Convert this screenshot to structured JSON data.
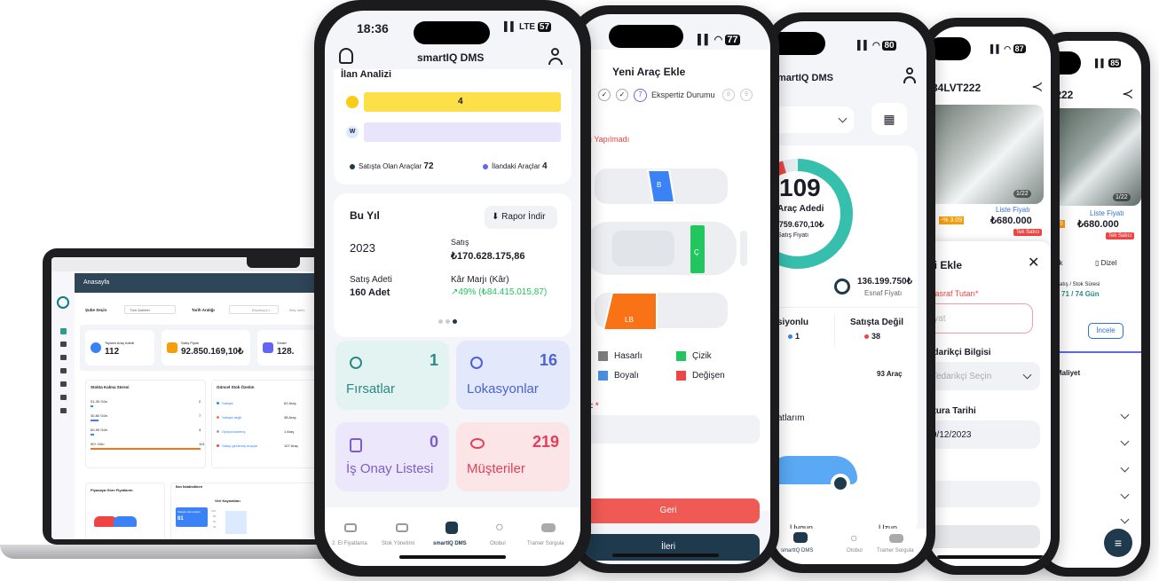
{
  "laptop": {
    "title": "Anasayfa",
    "branch_label": "Şube Seçin",
    "branch_value": "Tüm Şubeler",
    "date_label": "Tarih Aralığı",
    "date_start": "Başlangıç t...",
    "date_end": "Bitiş tarihi",
    "stats": [
      {
        "label": "Toplam Araç Adedi",
        "value": "112"
      },
      {
        "label": "Satış Fiyatı",
        "value": "92.850.169,10₺"
      },
      {
        "label": "Smart",
        "value": "128."
      }
    ],
    "stock_title": "Stokta Kalma Süresi",
    "stock_rows": [
      {
        "label": "01-30 Gün",
        "value": "2",
        "fill": 0.02
      },
      {
        "label": "30-60 Gün",
        "value": "7",
        "fill": 0.07
      },
      {
        "label": "60-90 Gün",
        "value": "3",
        "fill": 0.03
      },
      {
        "label": "90+ Gün",
        "value": "101",
        "fill": 1
      }
    ],
    "summary_title": "Güncel Stok Özetim",
    "summary_rows": [
      {
        "label": "Satışta",
        "value": "81 Araç",
        "color": "#3b82f6"
      },
      {
        "label": "Satışta değil",
        "value": "38 Araç",
        "color": "#f87171"
      },
      {
        "label": "Opsiyonlanmış",
        "value": "1 Araç",
        "color": "#a3a3a3"
      },
      {
        "label": "Satışı gecikmiş araçlar",
        "value": "107 Araç",
        "color": "#ef4444"
      }
    ],
    "market_title": "Piyasaya Göre Fiyatlarım",
    "ad_title": "İlan İstatistikleri",
    "source_title": "Veri Kaynakları",
    "source_box": "Satışta olan araçlar",
    "source_value": "81",
    "y_ticks": [
      "100",
      "80",
      "60",
      "40"
    ]
  },
  "phone1": {
    "time": "18:36",
    "signal": "LTE",
    "battery": "57",
    "app_title": "smartIQ DMS",
    "section": "İlan Analizi",
    "bar1_value": "4",
    "legend1_label": "Satışta Olan Araçlar",
    "legend1_value": "72",
    "legend2_label": "İlandaki Araçlar",
    "legend2_value": "4",
    "year_title": "Bu Yıl",
    "report_button": "Rapor İndir",
    "year": "2023",
    "sales_label": "Satış",
    "sales_value": "₺170.628.175,86",
    "count_label": "Satış Adeti",
    "count_value": "160 Adet",
    "margin_label": "Kâr Marjı (Kâr)",
    "margin_value": "↗49% (₺84.415.015,87)",
    "tiles": [
      {
        "label": "Fırsatlar",
        "value": "1"
      },
      {
        "label": "Lokasyonlar",
        "value": "16"
      },
      {
        "label": "İş Onay Listesi",
        "value": "0"
      },
      {
        "label": "Müşteriler",
        "value": "219"
      }
    ],
    "nav": [
      "2. El Fiyatlama",
      "Stok Yönetimi",
      "smartIQ DMS",
      "Otobul",
      "Tramer Sorgula"
    ]
  },
  "phone2": {
    "battery": "77",
    "title": "Yeni Araç Ekle",
    "step_number": "7",
    "step_label": "Ekspertiz Durumu",
    "step8": "8",
    "step9": "9",
    "warning": "Hiç Yapılmadı",
    "part_b": "B",
    "part_c": "Ç",
    "part_lb": "LB",
    "legend": [
      {
        "label": "Hasarlı",
        "color": "#7d7d7d"
      },
      {
        "label": "Çizik",
        "color": "#22c55e"
      },
      {
        "label": "Boyalı",
        "color": "#4a90e2"
      },
      {
        "label": "Değişen",
        "color": "#ef4444"
      }
    ],
    "field_label": "tre:",
    "required": "*",
    "back_button": "Geri",
    "next_button": "İleri"
  },
  "phone3": {
    "battery": "80",
    "app_title": "martIQ DMS",
    "ring_value": "109",
    "ring_label": "Araç Adedi",
    "ring_price": "₺759.670,10₺",
    "ring_caption": "Satış Fiyatı",
    "trader_value": "136.199.750₺",
    "trader_label": "Esnaf Fiyatı",
    "col1_label": "siyonlu",
    "col1_value": "1",
    "col2_label": "Satışta Değil",
    "col2_value": "38",
    "count_value": "93 Araç",
    "section": "atlarım",
    "bottom_a": "Uygun",
    "bottom_b": "Uzun",
    "nav": [
      "smartIQ DMS",
      "Otobul",
      "Tramer Sorgula"
    ]
  },
  "phone4": {
    "battery": "87",
    "plate": "34LVT222",
    "photo_counter": "1/22",
    "list_label": "Liste Fiyatı",
    "price": "₺680.000",
    "discount": "-% 3.09",
    "tag": "Tek Satıcı",
    "sheet_title": "si Ekle",
    "expense_label": "Masraf Tutarı",
    "expense_placeholder": "iyat",
    "supplier_label": "edarikçi Bilgisi",
    "supplier_placeholder": "Tedarikçi Seçin",
    "invoice_label": "atura Tarihi",
    "invoice_value": "9/12/2023"
  },
  "phone5": {
    "battery": "85",
    "plate": "VT222",
    "photo_counter": "1/22",
    "list_label": "Liste Fiyatı",
    "price": "₺680.000",
    "discount": "% 3.09",
    "tag": "Tek Satıcı",
    "chip_a": "omatik",
    "chip_b": "Dizel",
    "stock_label": "Satış / Stok Süresi",
    "stock_value": "71 / 74 Gün",
    "inspect_button": "İncele",
    "cost_label": "lam Maliyet"
  }
}
